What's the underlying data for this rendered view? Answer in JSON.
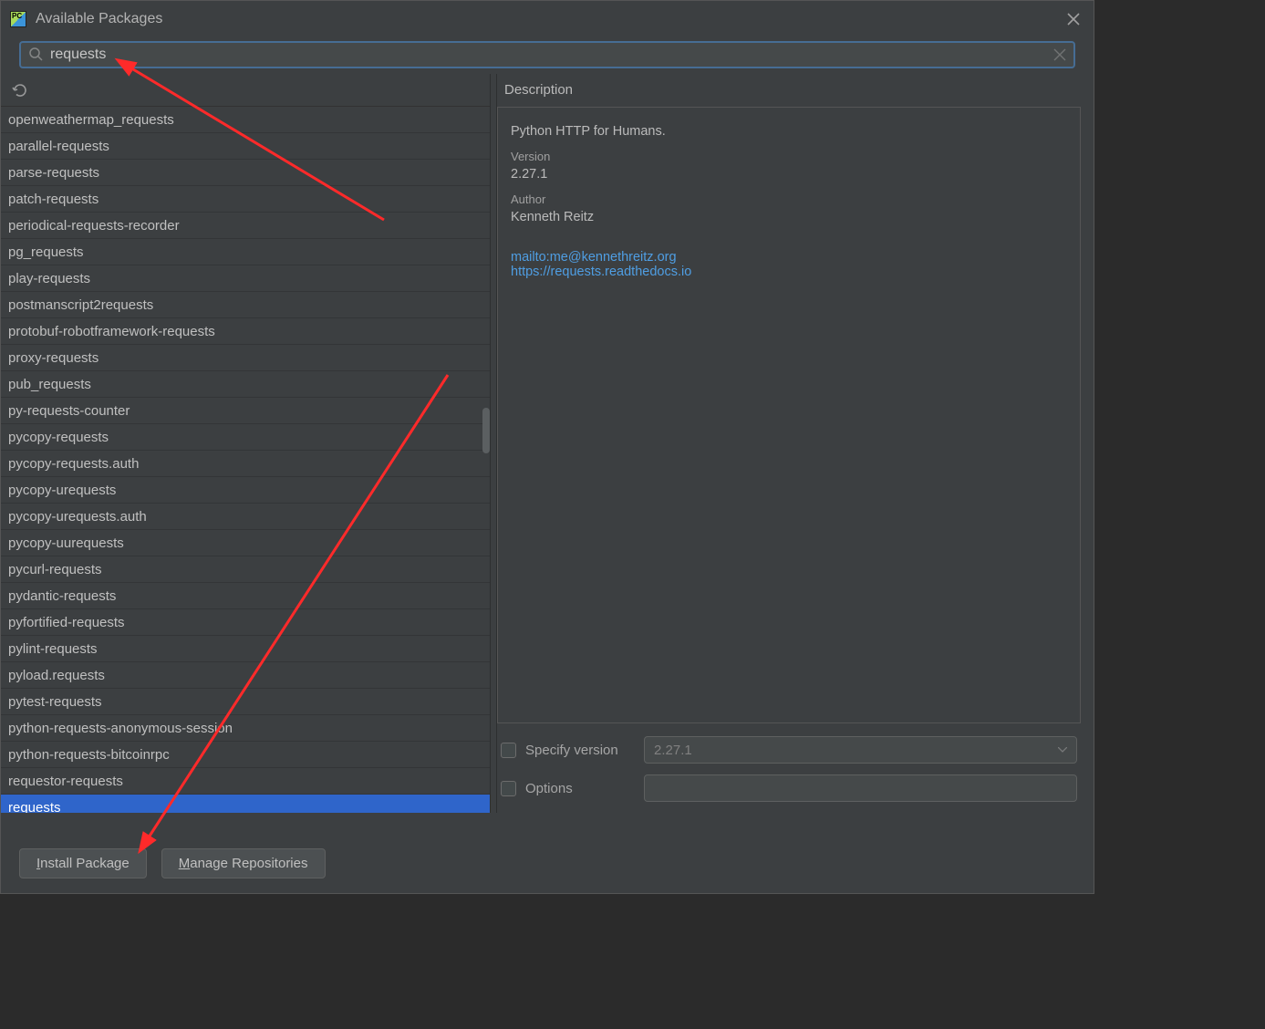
{
  "titlebar": {
    "title": "Available Packages"
  },
  "search": {
    "value": "requests"
  },
  "packages": [
    "openweathermap_requests",
    "parallel-requests",
    "parse-requests",
    "patch-requests",
    "periodical-requests-recorder",
    "pg_requests",
    "play-requests",
    "postmanscript2requests",
    "protobuf-robotframework-requests",
    "proxy-requests",
    "pub_requests",
    "py-requests-counter",
    "pycopy-requests",
    "pycopy-requests.auth",
    "pycopy-urequests",
    "pycopy-urequests.auth",
    "pycopy-uurequests",
    "pycurl-requests",
    "pydantic-requests",
    "pyfortified-requests",
    "pylint-requests",
    "pyload.requests",
    "pytest-requests",
    "python-requests-anonymous-session",
    "python-requests-bitcoinrpc",
    "requestor-requests",
    "requests"
  ],
  "selected_package_index": 26,
  "description": {
    "header": "Description",
    "summary": "Python HTTP for Humans.",
    "version_label": "Version",
    "version_value": "2.27.1",
    "author_label": "Author",
    "author_value": "Kenneth Reitz",
    "mailto": "mailto:me@kennethreitz.org",
    "homepage": "https://requests.readthedocs.io"
  },
  "options": {
    "specify_version_label": "Specify version",
    "specify_version_checked": false,
    "specify_version_value": "2.27.1",
    "options_label": "Options",
    "options_checked": false,
    "options_value": ""
  },
  "footer": {
    "install_label_pre": "I",
    "install_label_post": "nstall Package",
    "manage_label_pre": "M",
    "manage_label_post": "anage Repositories"
  }
}
